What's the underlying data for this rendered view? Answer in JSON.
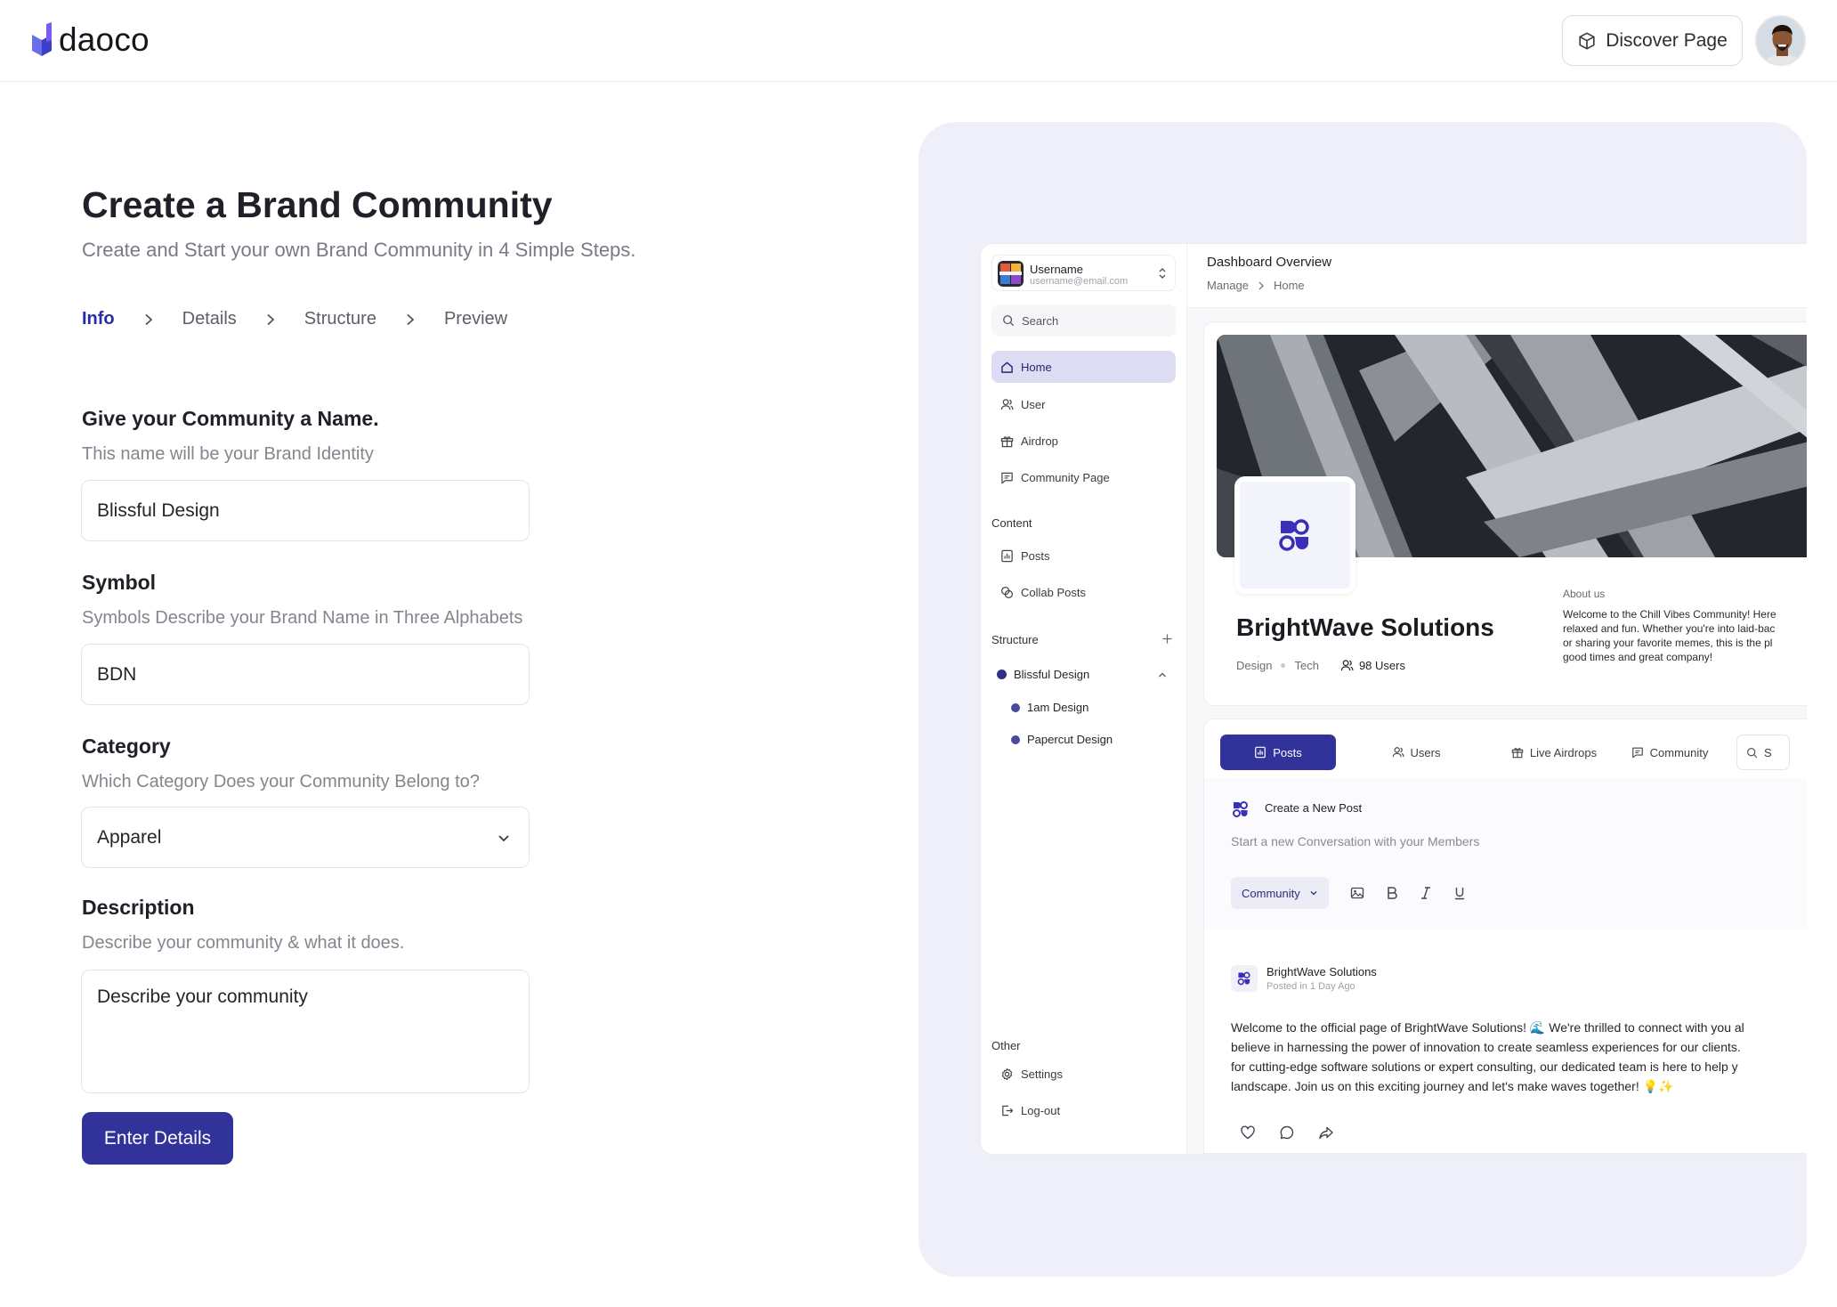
{
  "header": {
    "logo_text": "daoco",
    "discover_label": "Discover Page"
  },
  "form": {
    "title": "Create a Brand Community",
    "subtitle": "Create and Start your own Brand Community in 4 Simple Steps.",
    "steps": [
      {
        "label": "Info",
        "active": true
      },
      {
        "label": "Details",
        "active": false
      },
      {
        "label": "Structure",
        "active": false
      },
      {
        "label": "Preview",
        "active": false
      }
    ],
    "name": {
      "label": "Give your Community a Name.",
      "hint": "This name will be your Brand Identity",
      "value": "Blissful Design"
    },
    "symbol": {
      "label": "Symbol",
      "hint": "Symbols Describe your Brand Name in Three Alphabets",
      "value": "BDN"
    },
    "category": {
      "label": "Category",
      "hint": "Which Category Does your Community Belong to?",
      "value": "Apparel"
    },
    "description": {
      "label": "Description",
      "hint": "Describe your community & what it does.",
      "placeholder": "Describe your community"
    },
    "submit_label": "Enter Details"
  },
  "preview": {
    "sidebar": {
      "username": "Username",
      "email": "username@email.com",
      "search_placeholder": "Search",
      "nav": [
        {
          "label": "Home",
          "icon": "home-icon",
          "active": true
        },
        {
          "label": "User",
          "icon": "user-icon",
          "active": false
        },
        {
          "label": "Airdrop",
          "icon": "gift-icon",
          "active": false
        },
        {
          "label": "Community Page",
          "icon": "message-icon",
          "active": false
        }
      ],
      "content_heading": "Content",
      "content_items": [
        {
          "label": "Posts",
          "icon": "chart-icon"
        },
        {
          "label": "Collab Posts",
          "icon": "collab-icon"
        }
      ],
      "structure_heading": "Structure",
      "structure": {
        "root": "Blissful Design",
        "children": [
          "1am Design",
          "Papercut Design"
        ]
      },
      "other_heading": "Other",
      "other_items": [
        {
          "label": "Settings",
          "icon": "gear-icon"
        },
        {
          "label": "Log-out",
          "icon": "logout-icon"
        }
      ]
    },
    "main": {
      "title": "Dashboard Overview",
      "breadcrumb": [
        "Manage",
        "Home"
      ],
      "brand_name": "BrightWave Solutions",
      "tags": [
        "Design",
        "Tech"
      ],
      "users_count": "98 Users",
      "about_heading": "About us",
      "about_lines": [
        "Welcome to the Chill Vibes Community! Here",
        "relaxed and fun. Whether you're into laid-bac",
        "or sharing your favorite memes, this is the pl",
        "good times and great company!"
      ],
      "tabs": [
        {
          "label": "Posts",
          "icon": "chart-icon",
          "active": true
        },
        {
          "label": "Users",
          "icon": "user-icon",
          "active": false
        },
        {
          "label": "Live Airdrops",
          "icon": "gift-icon",
          "active": false
        },
        {
          "label": "Community",
          "icon": "message-icon",
          "active": false
        }
      ],
      "tab_search": "S",
      "new_post": {
        "title": "Create a New Post",
        "placeholder": "Start a new Conversation with your Members",
        "audience": "Community"
      },
      "post": {
        "author": "BrightWave Solutions",
        "meta": "Posted in 1 Day Ago",
        "body_lines": [
          "Welcome to the official page of BrightWave Solutions! 🌊 We're thrilled to connect with you al",
          "believe in harnessing the power of innovation to create seamless experiences for our clients.",
          "for cutting-edge software solutions or expert consulting, our dedicated team is here to help y",
          "landscape. Join us on this exciting journey and let's make waves together! 💡✨"
        ]
      }
    }
  },
  "colors": {
    "primary": "#32339a",
    "preview_bg": "#efeffa",
    "active_nav_bg": "#dcdcf3"
  }
}
